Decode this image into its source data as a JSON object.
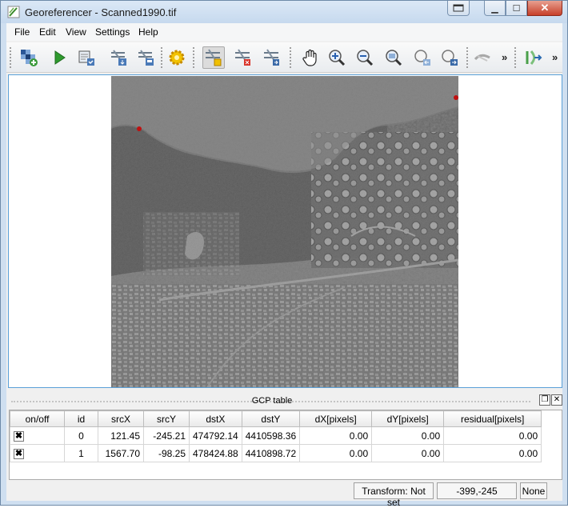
{
  "window": {
    "title": "Georeferencer - Scanned1990.tif"
  },
  "menu": [
    "File",
    "Edit",
    "View",
    "Settings",
    "Help"
  ],
  "toolbar": {
    "icons": [
      "open-raster-icon",
      "start-georeferencing-icon",
      "generate-gdal-script-icon",
      "load-gcp-points-icon",
      "save-gcp-points-icon",
      "transformation-settings-icon",
      "add-point-icon",
      "delete-point-icon",
      "move-gcp-point-icon",
      "pan-icon",
      "zoom-in-icon",
      "zoom-out-icon",
      "zoom-to-layer-icon",
      "zoom-last-icon",
      "zoom-next-icon",
      "link-georeferencer-to-qgis-icon",
      "link-qgis-to-georeferencer-icon"
    ],
    "overflow_1": "»",
    "overflow_2": "»"
  },
  "dock": {
    "title": "GCP table"
  },
  "gcp_table": {
    "headers": [
      "on/off",
      "id",
      "srcX",
      "srcY",
      "dstX",
      "dstY",
      "dX[pixels]",
      "dY[pixels]",
      "residual[pixels]"
    ],
    "rows": [
      {
        "on": true,
        "id": "0",
        "srcX": "121.45",
        "srcY": "-245.21",
        "dstX": "474792.14",
        "dstY": "4410598.36",
        "dX": "0.00",
        "dY": "0.00",
        "residual": "0.00"
      },
      {
        "on": true,
        "id": "1",
        "srcX": "1567.70",
        "srcY": "-98.25",
        "dstX": "478424.88",
        "dstY": "4410898.72",
        "dX": "0.00",
        "dY": "0.00",
        "residual": "0.00"
      }
    ]
  },
  "status": {
    "transform": "Transform: Not set",
    "coords": "-399,-245",
    "crs": "None"
  }
}
